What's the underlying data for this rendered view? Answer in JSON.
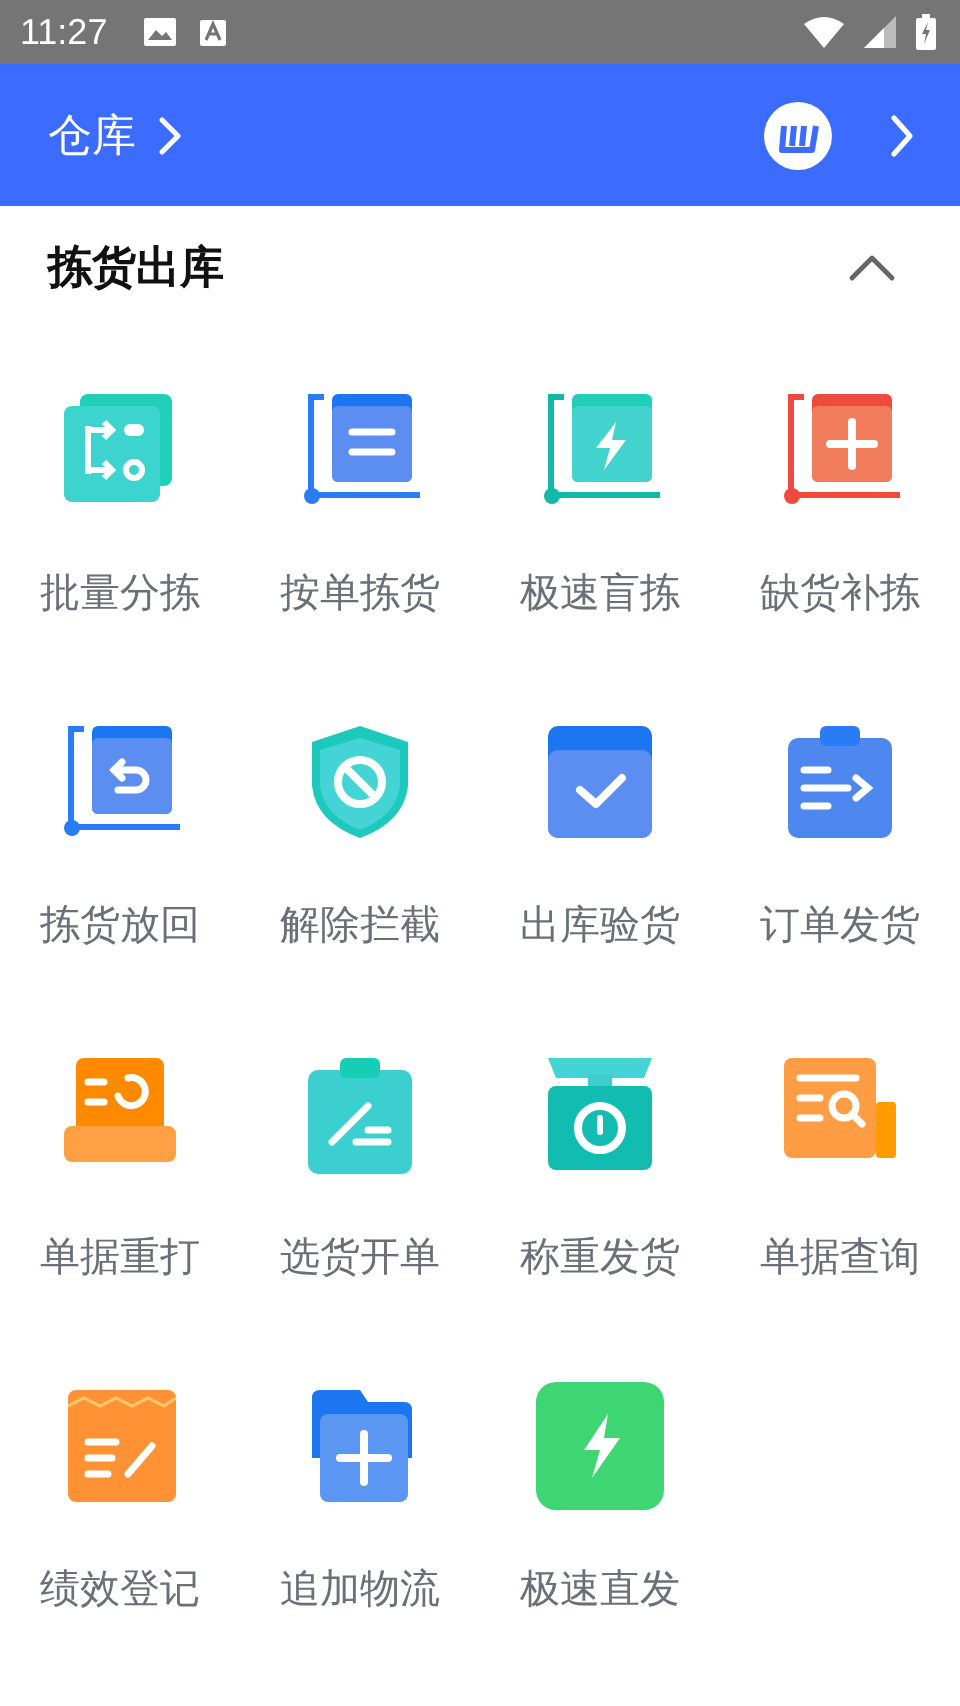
{
  "status_bar": {
    "time": "11:27"
  },
  "header": {
    "title": "仓库"
  },
  "section": {
    "title": "拣货出库",
    "expanded": true,
    "items": [
      {
        "label": "批量分拣"
      },
      {
        "label": "按单拣货"
      },
      {
        "label": "极速盲拣"
      },
      {
        "label": "缺货补拣"
      },
      {
        "label": "拣货放回"
      },
      {
        "label": "解除拦截"
      },
      {
        "label": "出库验货"
      },
      {
        "label": "订单发货"
      },
      {
        "label": "单据重打"
      },
      {
        "label": "选货开单"
      },
      {
        "label": "称重发货"
      },
      {
        "label": "单据查询"
      },
      {
        "label": "绩效登记"
      },
      {
        "label": "追加物流"
      },
      {
        "label": "极速直发"
      }
    ]
  }
}
